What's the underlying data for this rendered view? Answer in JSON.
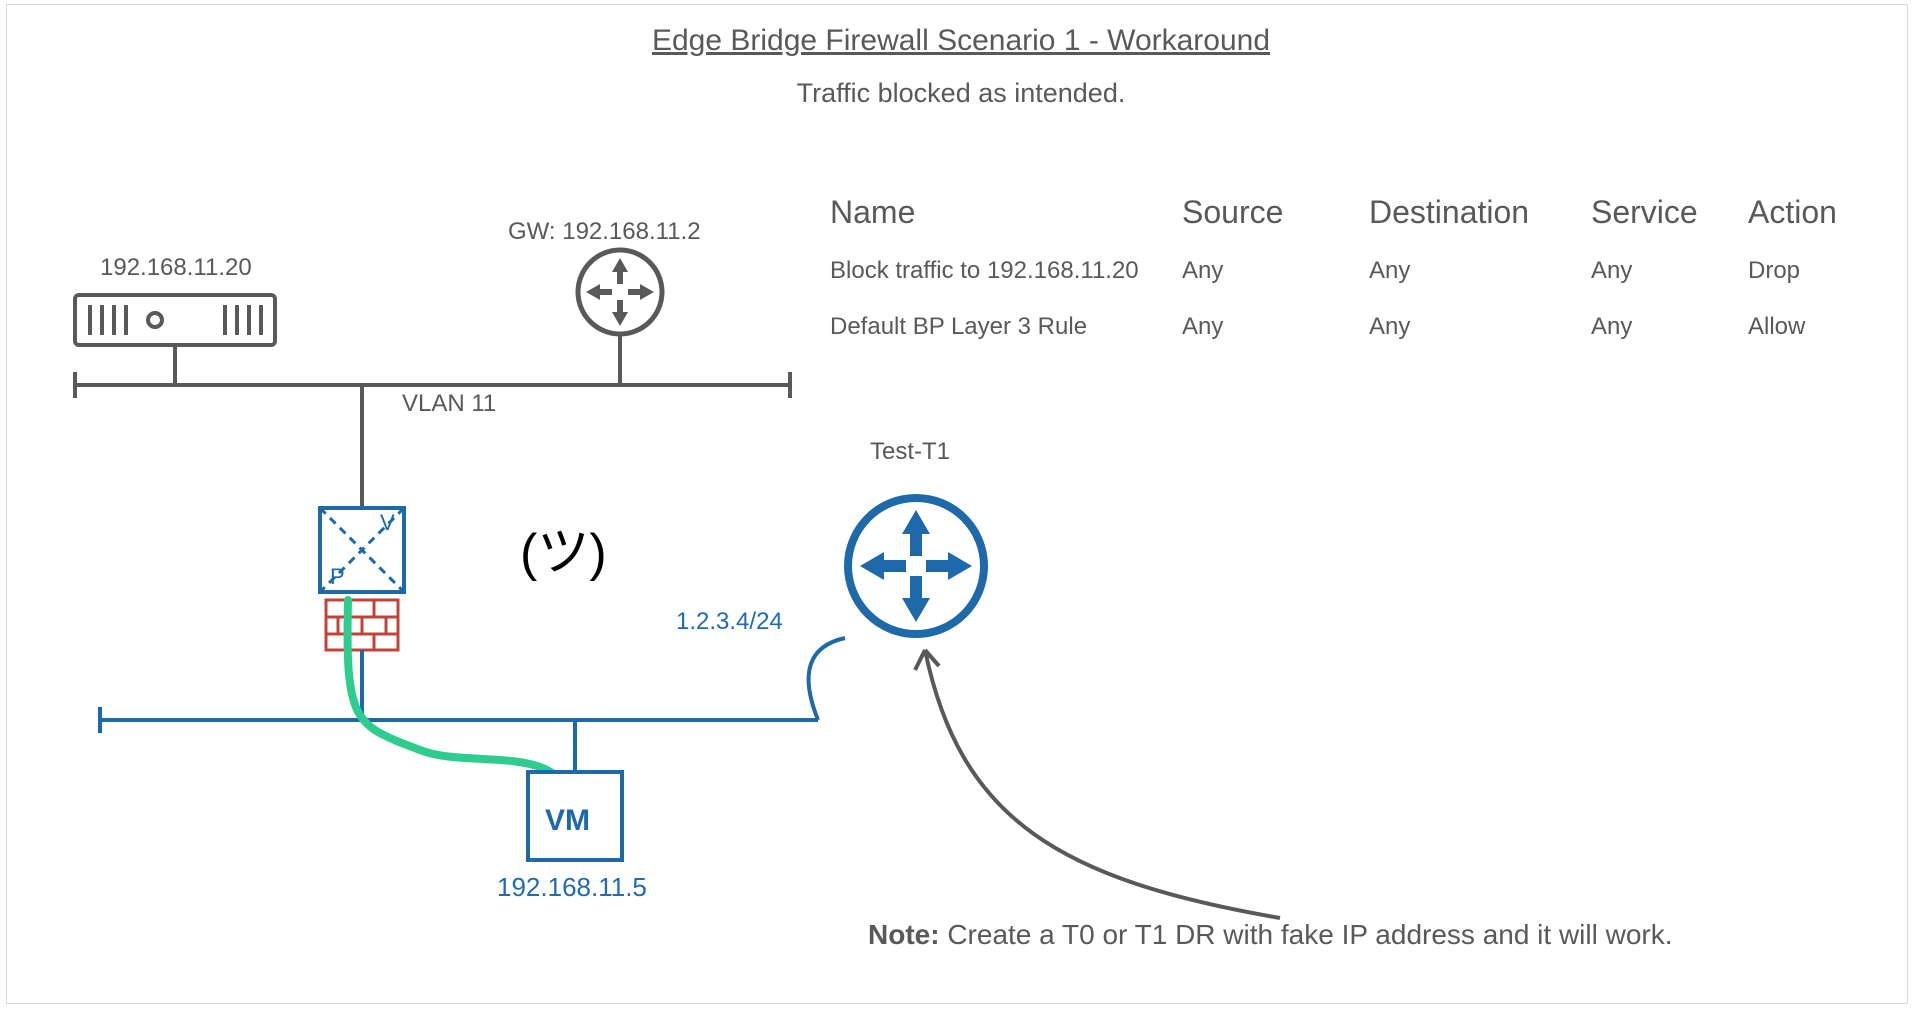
{
  "title": "Edge Bridge Firewall Scenario 1 - Workaround",
  "subtitle": "Traffic blocked as intended.",
  "server_ip": "192.168.11.20",
  "gateway_label": "GW: 192.168.11.2",
  "vlan_label": "VLAN 11",
  "smiley": "(ツ)",
  "fake_ip": "1.2.3.4/24",
  "t1_label": "Test-T1",
  "vm_text": "VM",
  "vm_ip": "192.168.11.5",
  "note_prefix": "Note:",
  "note_body": " Create a T0 or T1 DR with fake IP address and it will work.",
  "table": {
    "headers": {
      "name": "Name",
      "source": "Source",
      "destination": "Destination",
      "service": "Service",
      "action": "Action"
    },
    "rows": [
      {
        "name": "Block traffic to 192.168.11.20",
        "source": "Any",
        "destination": "Any",
        "service": "Any",
        "action": "Drop",
        "action_class": "drop"
      },
      {
        "name": "Default BP Layer 3 Rule",
        "source": "Any",
        "destination": "Any",
        "service": "Any",
        "action": "Allow",
        "action_class": ""
      }
    ]
  }
}
